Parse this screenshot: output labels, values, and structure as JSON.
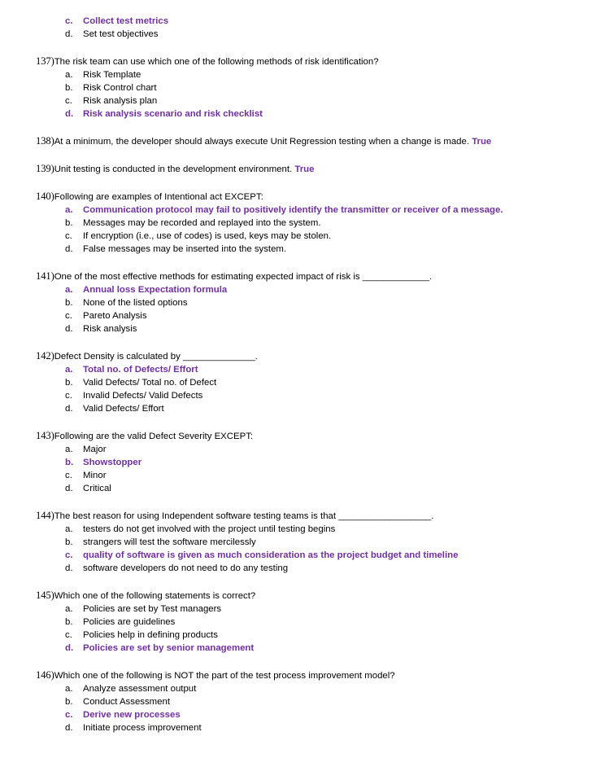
{
  "document": {
    "type": "multiple-choice-quiz",
    "accent_color": "#7030A0",
    "text_color": "#000000",
    "background_color": "#FFFFFF"
  },
  "continuation": {
    "options": [
      {
        "letter": "c.",
        "text": "Collect test metrics",
        "answer": true
      },
      {
        "letter": "d.",
        "text": "Set test objectives",
        "answer": false
      }
    ]
  },
  "questions": [
    {
      "number": "137)",
      "stem": "The risk team can use which one of the following methods of risk identification?",
      "inline_answer": "",
      "options": [
        {
          "letter": "a.",
          "text": "Risk Template",
          "answer": false
        },
        {
          "letter": "b.",
          "text": "Risk Control chart",
          "answer": false
        },
        {
          "letter": "c.",
          "text": "Risk analysis plan",
          "answer": false
        },
        {
          "letter": "d.",
          "text": "Risk analysis scenario and risk checklist",
          "answer": true
        }
      ]
    },
    {
      "number": "138)",
      "stem": "At a minimum, the developer should always execute Unit Regression testing when a change is made. ",
      "inline_answer": "True",
      "options": []
    },
    {
      "number": "139)",
      "stem": "Unit testing is conducted in the development environment. ",
      "inline_answer": "True",
      "options": []
    },
    {
      "number": "140)",
      "stem": "Following are examples of Intentional act EXCEPT:",
      "inline_answer": "",
      "options": [
        {
          "letter": "a.",
          "text": "Communication protocol may fail to positively identify the transmitter or receiver of a message.",
          "answer": true
        },
        {
          "letter": "b.",
          "text": "Messages may be recorded and replayed into the system.",
          "answer": false
        },
        {
          "letter": "c.",
          "text": "If encryption (i.e., use of codes) is used, keys may be stolen.",
          "answer": false
        },
        {
          "letter": "d.",
          "text": "False messages may be inserted into the system.",
          "answer": false
        }
      ]
    },
    {
      "number": "141)",
      "stem": "One of the most effective methods for estimating expected impact of risk is _____________.",
      "inline_answer": "",
      "options": [
        {
          "letter": "a.",
          "text": "Annual loss Expectation formula",
          "answer": true
        },
        {
          "letter": "b.",
          "text": "None of the listed options",
          "answer": false
        },
        {
          "letter": "c.",
          "text": "Pareto Analysis",
          "answer": false
        },
        {
          "letter": "d.",
          "text": "Risk analysis",
          "answer": false
        }
      ]
    },
    {
      "number": "142)",
      "stem": "Defect Density is calculated by ______________.",
      "inline_answer": "",
      "options": [
        {
          "letter": "a.",
          "text": "Total no. of Defects/ Effort",
          "answer": true
        },
        {
          "letter": "b.",
          "text": "Valid Defects/ Total no. of Defect",
          "answer": false
        },
        {
          "letter": "c.",
          "text": "Invalid Defects/ Valid Defects",
          "answer": false
        },
        {
          "letter": "d.",
          "text": "Valid Defects/ Effort",
          "answer": false
        }
      ]
    },
    {
      "number": "143)",
      "stem": "Following are the valid Defect Severity EXCEPT:",
      "inline_answer": "",
      "options": [
        {
          "letter": "a.",
          "text": "Major",
          "answer": false
        },
        {
          "letter": "b.",
          "text": "Showstopper",
          "answer": true
        },
        {
          "letter": "c.",
          "text": "Minor",
          "answer": false
        },
        {
          "letter": "d.",
          "text": "Critical",
          "answer": false
        }
      ]
    },
    {
      "number": "144)",
      "stem": "The best reason for using Independent software testing teams is that __________________.",
      "inline_answer": "",
      "options": [
        {
          "letter": "a.",
          "text": "testers do not get involved with the project until testing begins",
          "answer": false
        },
        {
          "letter": "b.",
          "text": "strangers will test the software mercilessly",
          "answer": false
        },
        {
          "letter": "c.",
          "text": "quality of software is given as much consideration as the project budget and timeline",
          "answer": true
        },
        {
          "letter": "d.",
          "text": "software developers do not need to do any testing",
          "answer": false
        }
      ]
    },
    {
      "number": "145)",
      "stem": "Which one of the following statements is correct?",
      "inline_answer": "",
      "options": [
        {
          "letter": "a.",
          "text": "Policies are set by Test managers",
          "answer": false
        },
        {
          "letter": "b.",
          "text": "Policies are guidelines",
          "answer": false
        },
        {
          "letter": "c.",
          "text": "Policies help in defining products",
          "answer": false
        },
        {
          "letter": "d.",
          "text": "Policies are set by senior management",
          "answer": true
        }
      ]
    },
    {
      "number": "146)",
      "stem": "Which one of the following is NOT the part of the test process improvement model?",
      "inline_answer": "",
      "options": [
        {
          "letter": "a.",
          "text": "Analyze assessment output",
          "answer": false
        },
        {
          "letter": "b.",
          "text": "Conduct Assessment",
          "answer": false
        },
        {
          "letter": "c.",
          "text": "Derive new processes",
          "answer": true
        },
        {
          "letter": "d.",
          "text": "Initiate process improvement",
          "answer": false
        }
      ]
    }
  ]
}
